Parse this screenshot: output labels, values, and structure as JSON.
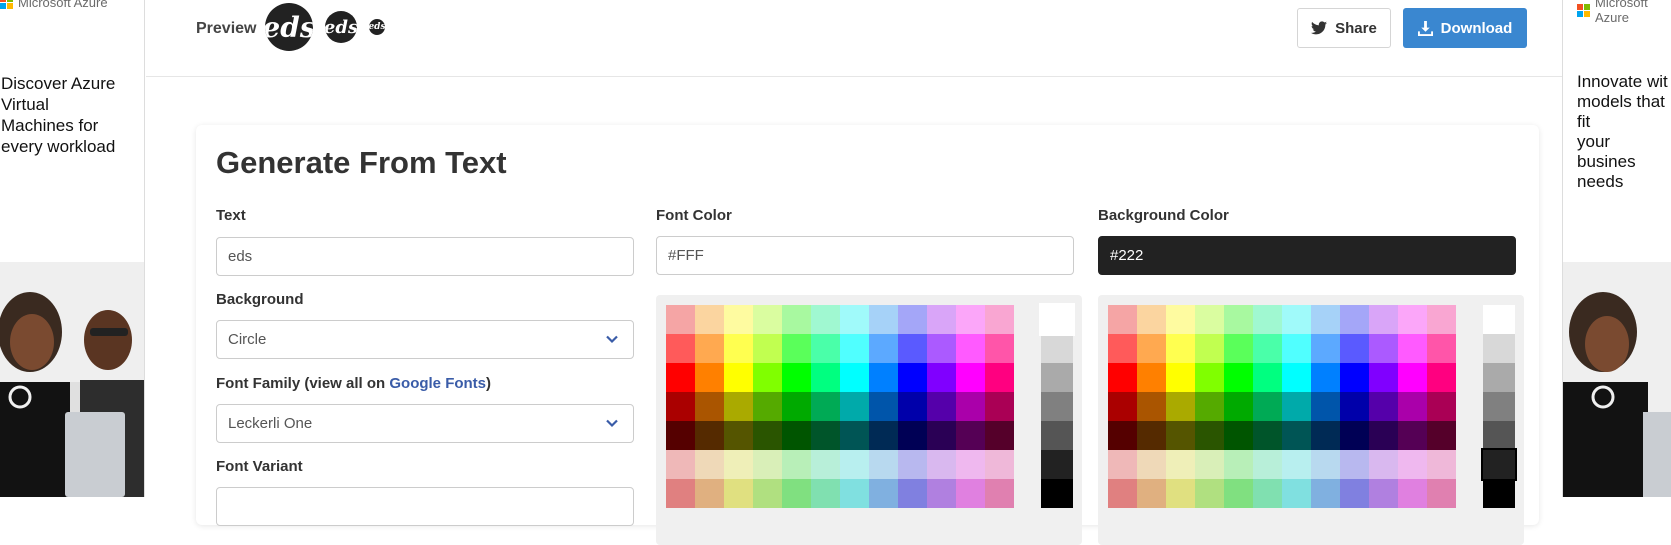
{
  "ads": {
    "left": {
      "brand": "Microsoft Azure",
      "lines": [
        "Discover Azure",
        "Virtual",
        "Machines for",
        "every workload"
      ]
    },
    "right": {
      "brand": "Microsoft Azure",
      "lines": [
        "Innovate wit",
        "models that",
        "fit",
        "your busines",
        "needs"
      ]
    }
  },
  "header": {
    "preview_label": "Preview",
    "preview_text": "eds",
    "share_label": "Share",
    "download_label": "Download"
  },
  "form": {
    "title": "Generate From Text",
    "text_label": "Text",
    "text_value": "eds",
    "background_label": "Background",
    "background_value": "Circle",
    "font_family_label_pre": "Font Family (view all on ",
    "font_family_link": "Google Fonts",
    "font_family_label_post": ")",
    "font_family_value": "Leckerli One",
    "font_variant_label": "Font Variant",
    "font_color_label": "Font Color",
    "font_color_value": "#FFF",
    "background_color_label": "Background Color",
    "background_color_value": "#222"
  },
  "colors": {
    "accent": "#3a87d0",
    "link": "#3a5ca8",
    "dark_field": "#222222",
    "palette_rows": [
      [
        "#f5a5a5",
        "#fbd5a0",
        "#fefba0",
        "#dafda0",
        "#a8f9a0",
        "#a0f8d1",
        "#a0fafa",
        "#a6d2f8",
        "#a4a6f8",
        "#d9a5f8",
        "#fba6f9",
        "#f9a6d2"
      ],
      [
        "#ff5a5a",
        "#ffa950",
        "#ffff50",
        "#c1ff50",
        "#5aff5a",
        "#4affa9",
        "#50ffff",
        "#5ca9ff",
        "#5a5aff",
        "#ab5aff",
        "#ff5aff",
        "#ff55a9"
      ],
      [
        "#ff0000",
        "#ff8000",
        "#ffff00",
        "#80ff00",
        "#00ff00",
        "#00ff80",
        "#00ffff",
        "#0080ff",
        "#0000ff",
        "#8000ff",
        "#ff00ff",
        "#ff0080"
      ],
      [
        "#aa0000",
        "#aa5500",
        "#aaaa00",
        "#55aa00",
        "#00aa00",
        "#00aa55",
        "#00aaaa",
        "#0055aa",
        "#0000aa",
        "#5500aa",
        "#aa00aa",
        "#aa0055"
      ],
      [
        "#550000",
        "#552a00",
        "#555500",
        "#2a5500",
        "#005500",
        "#00552a",
        "#005555",
        "#002a55",
        "#000055",
        "#2a0055",
        "#550055",
        "#55002a"
      ],
      [
        "#efb8b8",
        "#efd9b8",
        "#efefb8",
        "#d9efb8",
        "#b8efb8",
        "#b8efd9",
        "#b8efef",
        "#b8d9ef",
        "#b8b8ef",
        "#d9b8ef",
        "#efb8ef",
        "#efb8d9"
      ],
      [
        "#e08080",
        "#e0b080",
        "#e0e080",
        "#b0e080",
        "#80e080",
        "#80e0b0",
        "#80e0e0",
        "#80b0e0",
        "#8080e0",
        "#b080e0",
        "#e080e0",
        "#e080b0"
      ]
    ],
    "gray_col": [
      "#ffffff",
      "#d8d8d8",
      "#aaaaaa",
      "#808080",
      "#555555",
      "#222222",
      "#000000"
    ]
  }
}
